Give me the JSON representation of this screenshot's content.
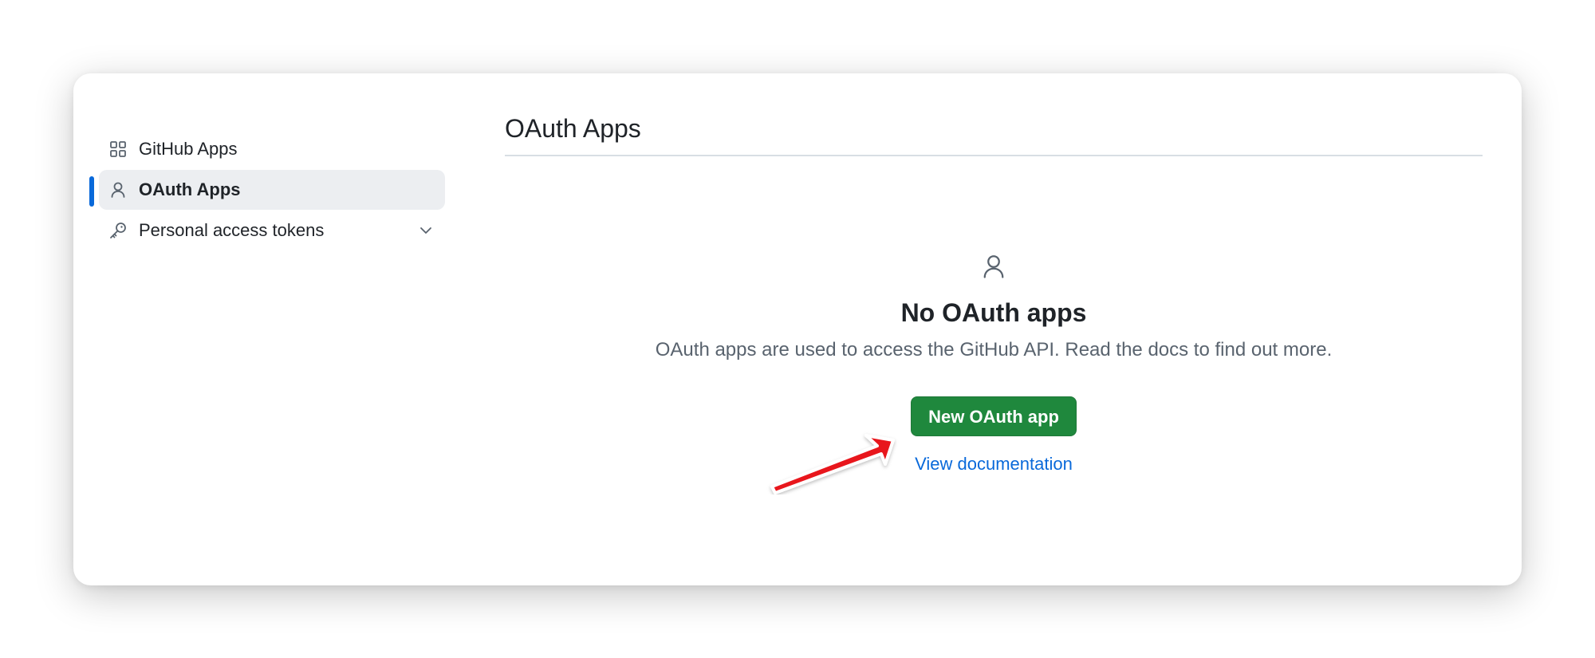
{
  "sidebar": {
    "items": [
      {
        "label": "GitHub Apps",
        "icon": "apps-grid-icon"
      },
      {
        "label": "OAuth Apps",
        "icon": "person-icon",
        "active": true
      },
      {
        "label": "Personal access tokens",
        "icon": "key-icon",
        "expandable": true
      }
    ]
  },
  "main": {
    "title": "OAuth Apps",
    "blankslate": {
      "icon": "person-icon",
      "heading": "No OAuth apps",
      "description": "OAuth apps are used to access the GitHub API. Read the docs to find out more.",
      "primary_button": "New OAuth app",
      "secondary_link": "View documentation"
    }
  },
  "colors": {
    "accent": "#0969da",
    "primary_button": "#1f883d",
    "annotation_arrow": "#e8141b"
  }
}
